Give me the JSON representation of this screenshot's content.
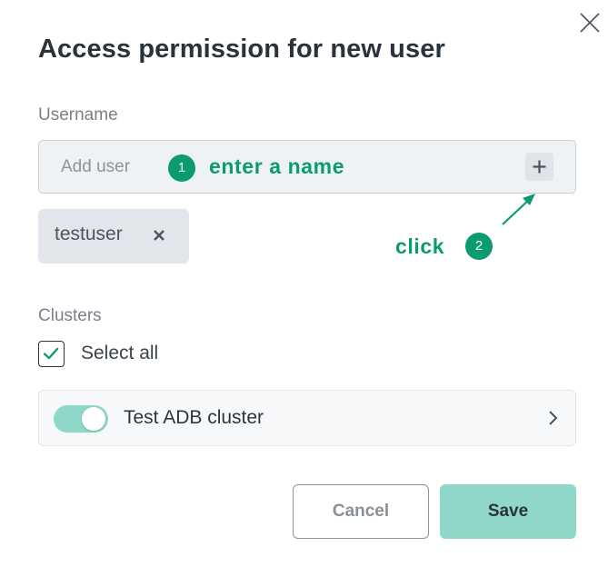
{
  "dialog": {
    "title": "Access permission for new user",
    "close_icon": "close-icon"
  },
  "username": {
    "label": "Username",
    "input_placeholder": "Add user",
    "input_value": "",
    "add_icon": "plus-icon",
    "chips": [
      {
        "label": "testuser",
        "remove_icon": "close-icon"
      }
    ]
  },
  "callouts": {
    "step1": {
      "number": "1",
      "text": "enter a name"
    },
    "step2": {
      "number": "2",
      "text": "click",
      "arrow_icon": "arrow-icon"
    },
    "color": "#0a9c6e"
  },
  "clusters": {
    "label": "Clusters",
    "select_all_label": "Select all",
    "select_all_checked": true,
    "items": [
      {
        "name": "Test ADB cluster",
        "enabled": true,
        "chevron_icon": "chevron-right-icon"
      }
    ]
  },
  "actions": {
    "cancel_label": "Cancel",
    "save_label": "Save"
  },
  "colors": {
    "accent": "#0a9c6e",
    "accent_light": "#8fd8c9"
  }
}
